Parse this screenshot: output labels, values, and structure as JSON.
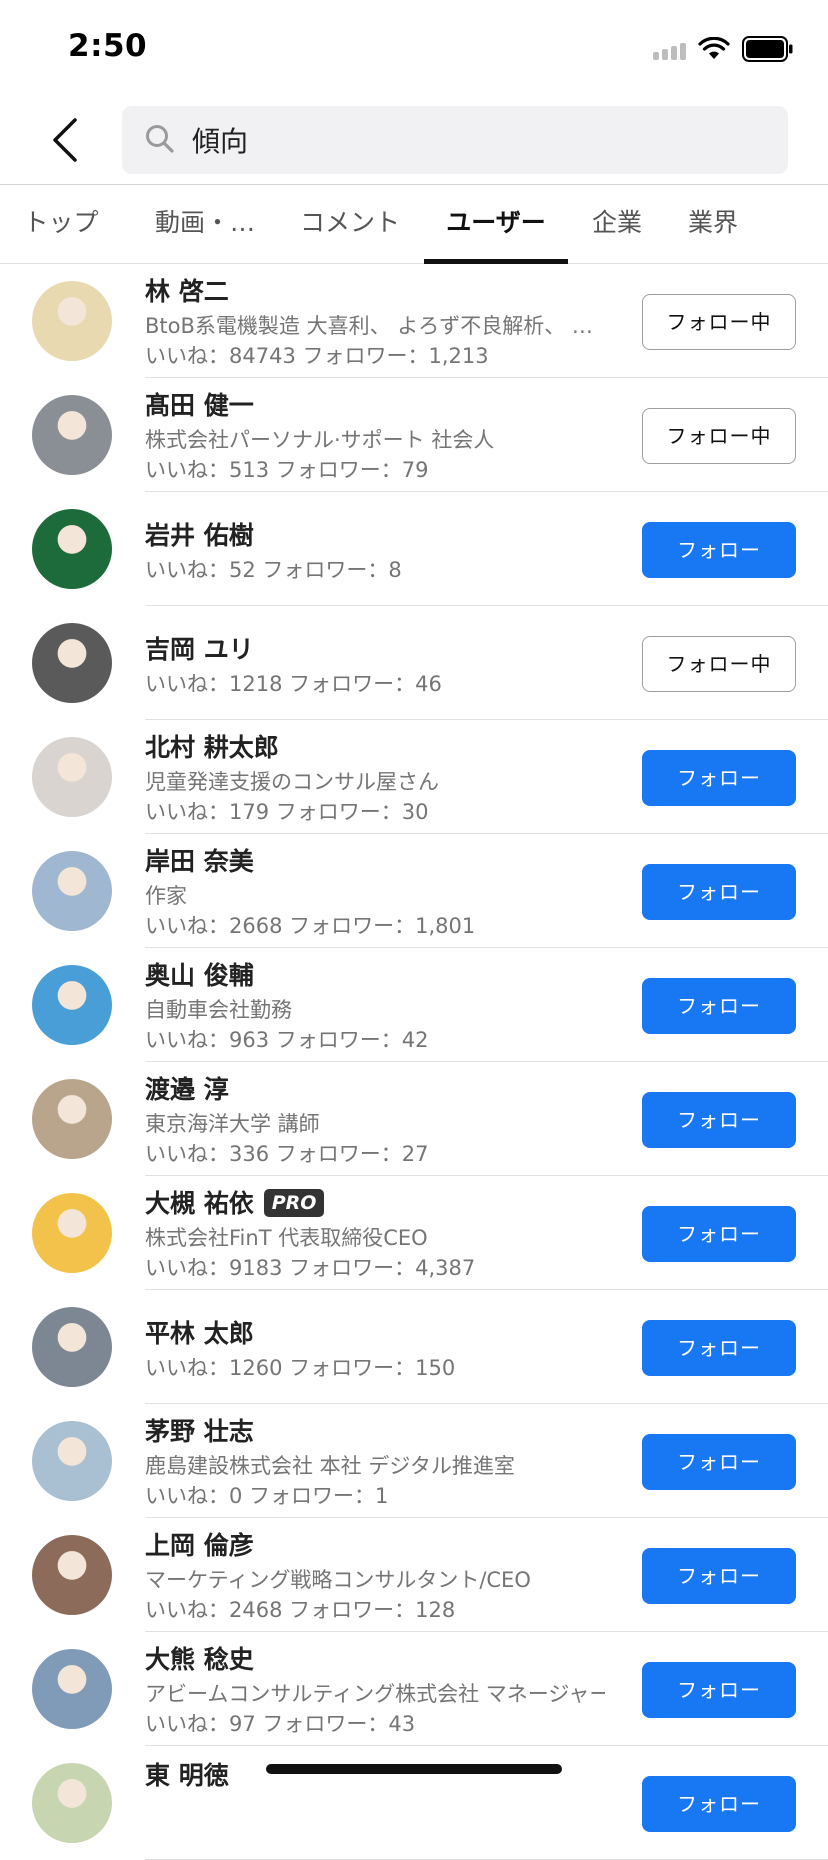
{
  "status_bar": {
    "time": "2:50"
  },
  "search": {
    "query": "傾向"
  },
  "tabs": [
    {
      "label": "トップ",
      "active": false
    },
    {
      "label": "動画・…",
      "active": false
    },
    {
      "label": "コメント",
      "active": false
    },
    {
      "label": "ユーザー",
      "active": true
    },
    {
      "label": "企業",
      "active": false
    },
    {
      "label": "業界",
      "active": false
    }
  ],
  "users": [
    {
      "name": "林 啓二",
      "description": "BtoB系電機製造 大喜利、 よろず不良解析、 …",
      "stats": "いいね：84743 フォロワー：1,213",
      "button": "フォロー中",
      "following": true,
      "pro": false,
      "avatar_color": "#e8d9b0"
    },
    {
      "name": "髙田 健一",
      "description": "株式会社パーソナル·サポート 社会人",
      "stats": "いいね：513 フォロワー：79",
      "button": "フォロー中",
      "following": true,
      "pro": false,
      "avatar_color": "#8a8f96"
    },
    {
      "name": "岩井 佑樹",
      "description": "",
      "stats": "いいね：52 フォロワー：8",
      "button": "フォロー",
      "following": false,
      "pro": false,
      "avatar_color": "#1d6b3a"
    },
    {
      "name": "吉岡 ユリ",
      "description": "",
      "stats": "いいね：1218 フォロワー：46",
      "button": "フォロー中",
      "following": true,
      "pro": false,
      "avatar_color": "#5a5a5a"
    },
    {
      "name": "北村 耕太郎",
      "description": "児童発達支援のコンサル屋さん",
      "stats": "いいね：179 フォロワー：30",
      "button": "フォロー",
      "following": false,
      "pro": false,
      "avatar_color": "#d9d4cf"
    },
    {
      "name": "岸田 奈美",
      "description": "作家",
      "stats": "いいね：2668 フォロワー：1,801",
      "button": "フォロー",
      "following": false,
      "pro": false,
      "avatar_color": "#9fb7d0"
    },
    {
      "name": "奥山 俊輔",
      "description": "自動車会社勤務",
      "stats": "いいね：963 フォロワー：42",
      "button": "フォロー",
      "following": false,
      "pro": false,
      "avatar_color": "#4a9ed8"
    },
    {
      "name": "渡邉 淳",
      "description": "東京海洋大学 講師",
      "stats": "いいね：336 フォロワー：27",
      "button": "フォロー",
      "following": false,
      "pro": false,
      "avatar_color": "#b9a58c"
    },
    {
      "name": "大槻 祐依",
      "description": "株式会社FinT 代表取締役CEO",
      "stats": "いいね：9183 フォロワー：4,387",
      "button": "フォロー",
      "following": false,
      "pro": true,
      "pro_label": "PRO",
      "avatar_color": "#f2c24a"
    },
    {
      "name": "平林 太郎",
      "description": "",
      "stats": "いいね：1260 フォロワー：150",
      "button": "フォロー",
      "following": false,
      "pro": false,
      "avatar_color": "#7d8794"
    },
    {
      "name": "茅野 壮志",
      "description": "鹿島建設株式会社 本社 デジタル推進室",
      "stats": "いいね：0 フォロワー：1",
      "button": "フォロー",
      "following": false,
      "pro": false,
      "avatar_color": "#a9bfd2"
    },
    {
      "name": "上岡 倫彦",
      "description": "マーケティング戦略コンサルタント/CEO",
      "stats": "いいね：2468 フォロワー：128",
      "button": "フォロー",
      "following": false,
      "pro": false,
      "avatar_color": "#8c6b5a"
    },
    {
      "name": "大熊 稔史",
      "description": "アビームコンサルティング株式会社 マネージャー",
      "stats": "いいね：97 フォロワー：43",
      "button": "フォロー",
      "following": false,
      "pro": false,
      "avatar_color": "#7f9bb8"
    },
    {
      "name": "東 明徳",
      "description": "",
      "stats": "",
      "button": "フォロー",
      "following": false,
      "pro": false,
      "avatar_color": "#c7d6b0"
    }
  ]
}
